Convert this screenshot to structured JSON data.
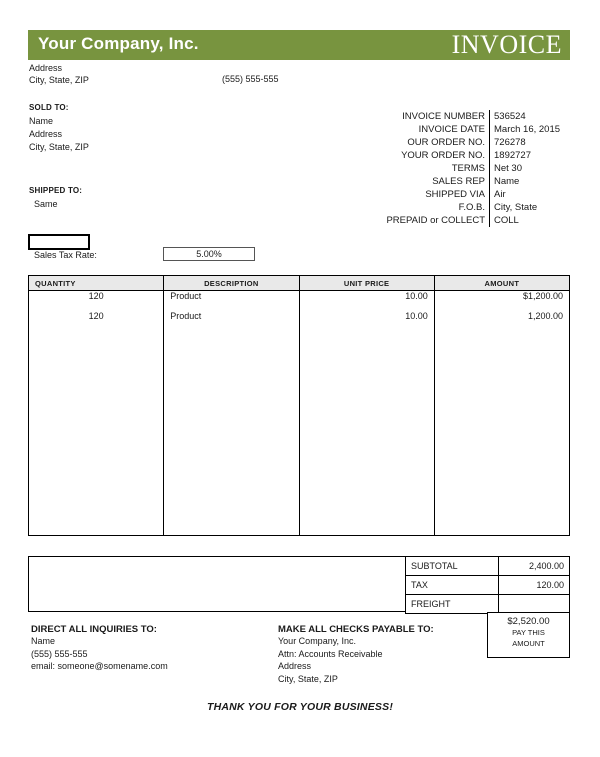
{
  "header": {
    "company_name": "Your Company, Inc.",
    "document_title": "INVOICE",
    "banner_color": "#78943f",
    "address_line1": "Address",
    "address_line2": "City, State, ZIP",
    "phone": "(555) 555-555"
  },
  "sold_to": {
    "title": "SOLD TO:",
    "line1": "Name",
    "line2": "Address",
    "line3": "City, State, ZIP"
  },
  "shipped_to": {
    "title": "SHIPPED TO:",
    "line1": "Same"
  },
  "meta": {
    "rows": [
      {
        "label": "INVOICE NUMBER",
        "value": "536524"
      },
      {
        "label": "INVOICE DATE",
        "value": "March 16, 2015"
      },
      {
        "label": "OUR ORDER NO.",
        "value": "726278"
      },
      {
        "label": "YOUR ORDER NO.",
        "value": "1892727"
      },
      {
        "label": "TERMS",
        "value": "Net 30"
      },
      {
        "label": "SALES REP",
        "value": "Name"
      },
      {
        "label": "SHIPPED VIA",
        "value": "Air"
      },
      {
        "label": "F.O.B.",
        "value": "City, State"
      },
      {
        "label": "PREPAID or COLLECT",
        "value": "COLL"
      }
    ]
  },
  "tax_rate": {
    "label": "Sales Tax Rate:",
    "value": "5.00%",
    "blank_box_value": ""
  },
  "items": {
    "headers": {
      "quantity": "QUANTITY",
      "description": "DESCRIPTION",
      "unit_price": "UNIT PRICE",
      "amount": "AMOUNT"
    },
    "rows": [
      {
        "quantity": "120",
        "description": "Product",
        "unit_price": "10.00",
        "amount": "$1,200.00"
      },
      {
        "quantity": "120",
        "description": "Product",
        "unit_price": "10.00",
        "amount": "1,200.00"
      }
    ]
  },
  "totals": {
    "subtotal_label": "SUBTOTAL",
    "subtotal_value": "2,400.00",
    "tax_label": "TAX",
    "tax_value": "120.00",
    "freight_label": "FREIGHT",
    "freight_value": "",
    "pay_amount": "$2,520.00",
    "pay_line1": "PAY THIS",
    "pay_line2": "AMOUNT"
  },
  "footer": {
    "inquiries_title": "DIRECT ALL INQUIRIES TO:",
    "inquiries_line1": "Name",
    "inquiries_line2": "(555) 555-555",
    "inquiries_line3": "email: someone@somename.com",
    "payable_title": "MAKE ALL CHECKS PAYABLE TO:",
    "payable_line1": "Your Company, Inc.",
    "payable_line2": "Attn: Accounts Receivable",
    "payable_line3": "Address",
    "payable_line4": "City, State, ZIP",
    "thanks": "THANK YOU FOR YOUR BUSINESS!"
  }
}
